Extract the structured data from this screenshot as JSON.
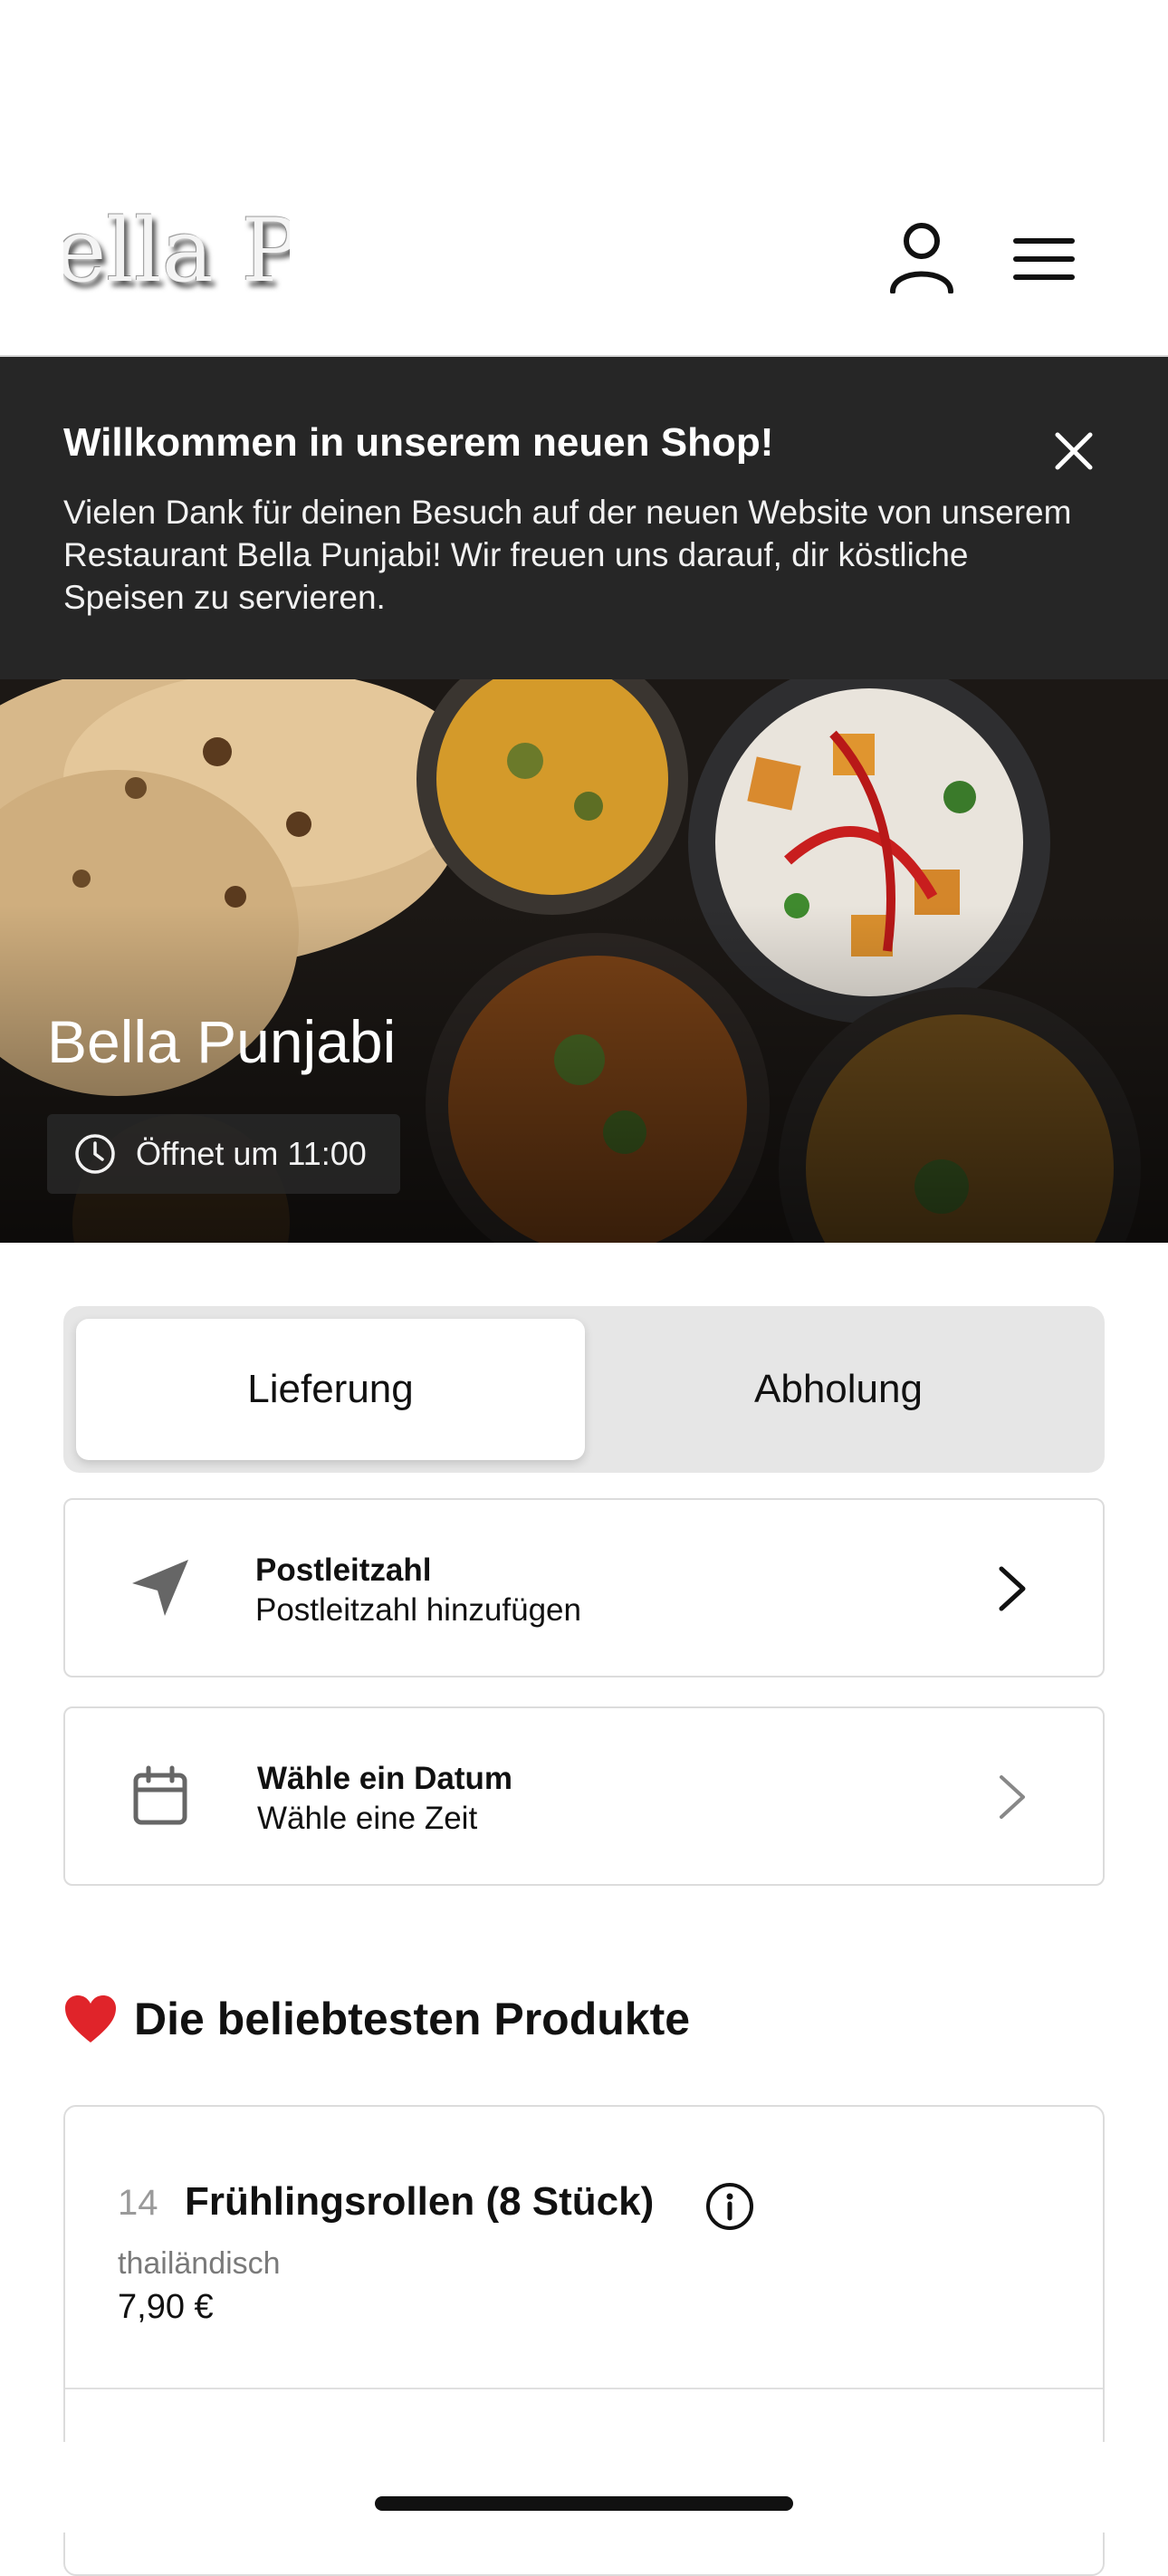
{
  "header": {
    "logo_text": "Bella Punjabi",
    "logo_visible_fragment": "a Pun"
  },
  "banner": {
    "title": "Willkommen in unserem neuen Shop!",
    "text": "Vielen Dank für deinen Besuch auf der neuen Website von unserem Restaurant Bella Punjabi! Wir freuen uns darauf, dir köstliche Speisen zu servieren."
  },
  "hero": {
    "restaurant_name": "Bella Punjabi",
    "open_status": "Öffnet um 11:00"
  },
  "order_mode": {
    "options": [
      "Lieferung",
      "Abholung"
    ],
    "selected": "Lieferung"
  },
  "postcode_card": {
    "title": "Postleitzahl",
    "subtitle": "Postleitzahl hinzufügen"
  },
  "date_card": {
    "title": "Wähle ein Datum",
    "subtitle": "Wähle eine Zeit"
  },
  "popular": {
    "title": "Die beliebtesten Produkte",
    "items": [
      {
        "number": "14",
        "name": "Frühlingsrollen (8 Stück)",
        "category": "thailändisch",
        "price": "7,90 €"
      }
    ]
  },
  "colors": {
    "banner_bg": "#262626",
    "toggle_bg": "#e6e6e6",
    "heart": "#e0242a"
  }
}
